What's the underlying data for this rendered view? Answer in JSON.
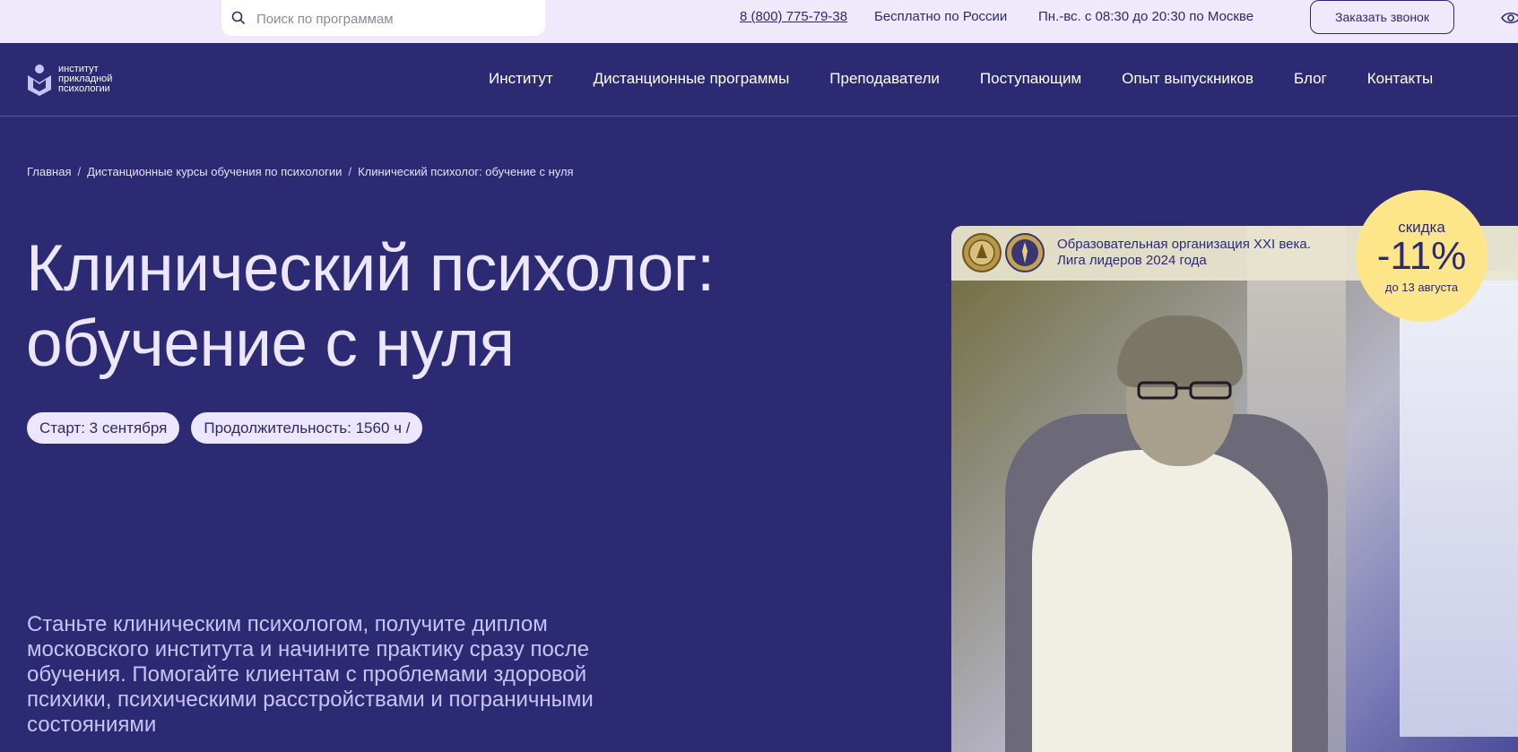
{
  "topbar": {
    "search_placeholder": "Поиск по программам",
    "phone": "8 (800) 775-79-38",
    "free_call": "Бесплатно по России",
    "hours": "Пн.-вс. с 08:30 до 20:30 по Москве",
    "callback_button": "Заказать звонок"
  },
  "logo": {
    "line1": "институт",
    "line2": "прикладной",
    "line3": "психологии"
  },
  "nav": {
    "items": [
      {
        "label": "Институт"
      },
      {
        "label": "Дистанционные программы"
      },
      {
        "label": "Преподаватели"
      },
      {
        "label": "Поступающим"
      },
      {
        "label": "Опыт выпускников"
      },
      {
        "label": "Блог"
      },
      {
        "label": "Контакты"
      }
    ]
  },
  "breadcrumb": {
    "items": [
      {
        "label": "Главная"
      },
      {
        "label": "Дистанционные курсы обучения по психологии"
      },
      {
        "label": "Клинический психолог: обучение с нуля"
      }
    ],
    "separator": "/"
  },
  "hero": {
    "title": "Клинический психолог: обучение с нуля",
    "chips": [
      {
        "label": "Старт: 3 сентября"
      },
      {
        "label": "Продолжительность: 1560 ч /"
      }
    ],
    "description": "Станьте клиническим психологом, получите диплом московского института и начините практику сразу после обучения. Помогайте клиентам с проблемами здоровой психики, психическими расстройствами и пограничными состояниями"
  },
  "award": {
    "line1": "Образовательная организация XXI века.",
    "line2": "Лига лидеров 2024 года"
  },
  "discount": {
    "label": "скидка",
    "value": "-11%",
    "until": "до 13 августа"
  },
  "colors": {
    "background": "#2b2a73",
    "topbar": "#efe9fb",
    "title": "#ece6ff",
    "discount_badge": "#fde68a"
  }
}
